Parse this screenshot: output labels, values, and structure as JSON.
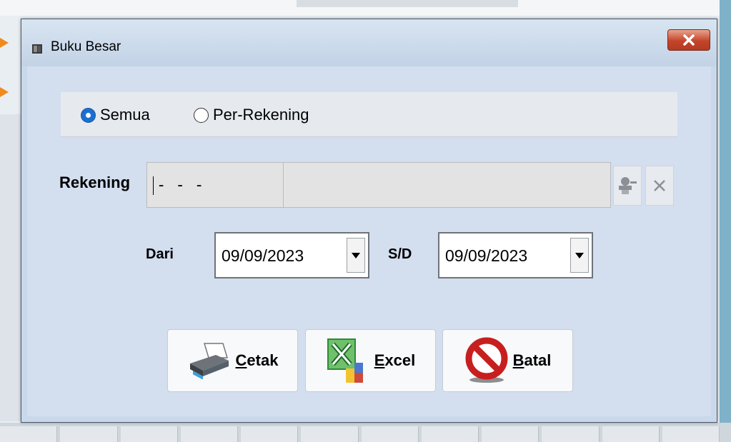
{
  "window": {
    "title": "Buku Besar",
    "close_label": "X"
  },
  "filter": {
    "options": [
      {
        "label": "Semua",
        "selected": true
      },
      {
        "label": "Per-Rekening",
        "selected": false
      }
    ]
  },
  "rekening": {
    "label": "Rekening",
    "code_value": "- - -",
    "name_value": ""
  },
  "dates": {
    "from_label": "Dari",
    "from_value": "09/09/2023",
    "to_label": "S/D",
    "to_value": "09/09/2023"
  },
  "actions": {
    "print": {
      "mnemonic": "C",
      "rest": "etak"
    },
    "excel": {
      "mnemonic": "E",
      "rest": "xcel"
    },
    "cancel": {
      "mnemonic": "B",
      "rest": "atal"
    }
  },
  "colors": {
    "accent": "#1c6fd0",
    "close": "#c4452a",
    "window_bg": "#c9d8ea"
  },
  "icons": [
    "window-icon",
    "close-icon",
    "lookup-icon",
    "clear-icon",
    "dropdown-arrow-icon",
    "printer-icon",
    "excel-icon",
    "no-sign-icon"
  ]
}
